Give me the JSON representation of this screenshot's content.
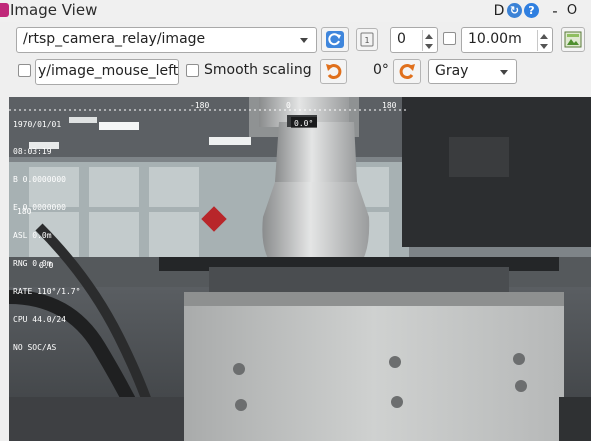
{
  "window": {
    "title": "Image View",
    "controls": {
      "d_label": "D",
      "minimize": "-",
      "close": "O"
    }
  },
  "toolbar": {
    "topic": "/rtsp_camera_relay/image",
    "spin_value": "0",
    "max_range": "10.00m",
    "mouse_topic": "y/image_mouse_left",
    "smooth_label": "Smooth scaling",
    "rotation": "0°",
    "color_scheme": "Gray"
  },
  "overlay": {
    "lines": [
      "1970/01/01",
      "08:03:19",
      "B 0.0000000",
      "E 0.0000000",
      "ASL 0.0m",
      "RNG 0.0m",
      "RATE 110°/1.7°",
      "CPU 44.0/24",
      "NO SOC/AS"
    ],
    "heading_ticks": [
      "-180",
      "0",
      "180"
    ],
    "heading_value": "0.0°",
    "left_scale_top": "180",
    "left_scale_val": "0.0"
  },
  "colors": {
    "accent_blue": "#2f7fe0",
    "orange": "#e0701c",
    "background": "#efefef"
  }
}
